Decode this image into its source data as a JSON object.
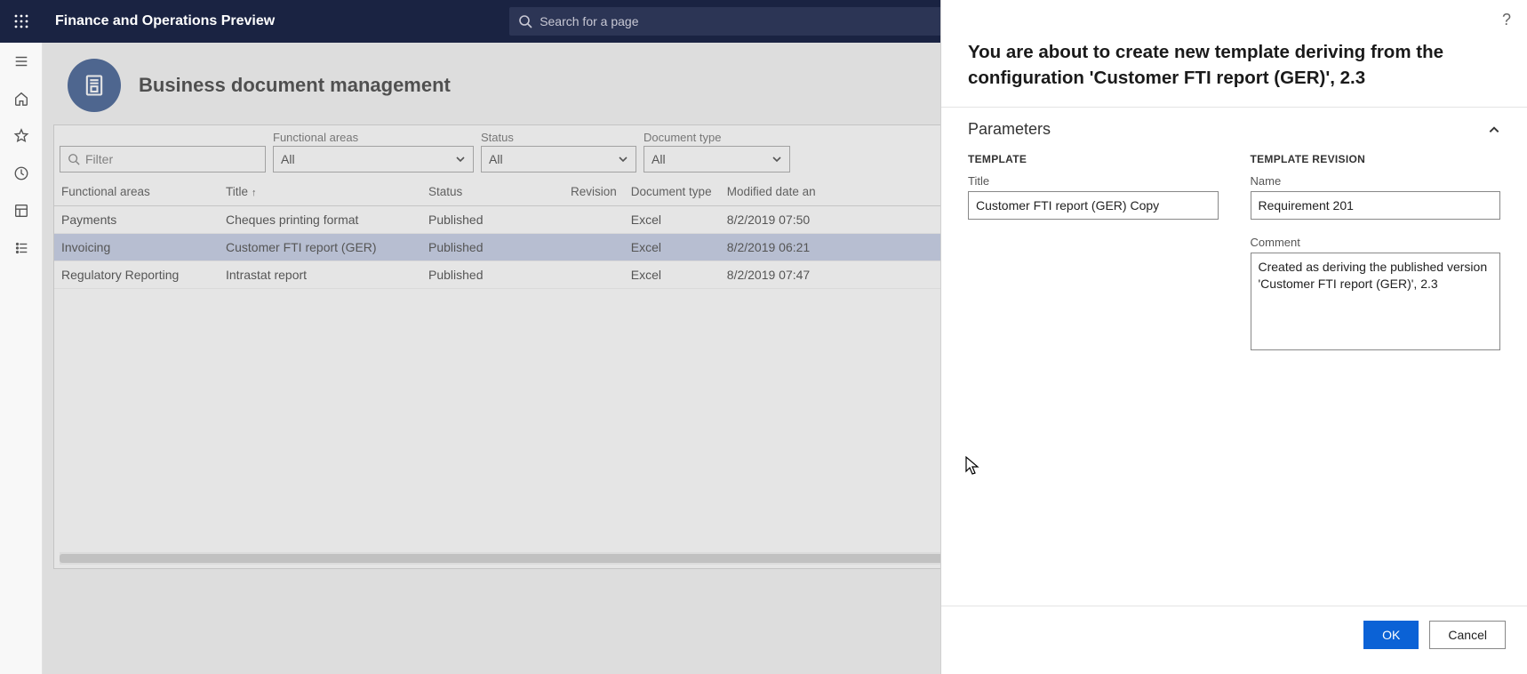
{
  "app_title": "Finance and Operations Preview",
  "search_placeholder": "Search for a page",
  "page_title": "Business document management",
  "filter_placeholder": "Filter",
  "filters": {
    "functional_areas": {
      "label": "Functional areas",
      "value": "All"
    },
    "status": {
      "label": "Status",
      "value": "All"
    },
    "document_type": {
      "label": "Document type",
      "value": "All"
    }
  },
  "columns": {
    "functional_areas": "Functional areas",
    "title": "Title",
    "status": "Status",
    "revision": "Revision",
    "document_type": "Document type",
    "modified": "Modified date an"
  },
  "rows": [
    {
      "fa": "Payments",
      "title": "Cheques printing format",
      "status": "Published",
      "revision": "",
      "doctype": "Excel",
      "modified": "8/2/2019 07:50"
    },
    {
      "fa": "Invoicing",
      "title": "Customer FTI report (GER)",
      "status": "Published",
      "revision": "",
      "doctype": "Excel",
      "modified": "8/2/2019 06:21"
    },
    {
      "fa": "Regulatory Reporting",
      "title": "Intrastat report",
      "status": "Published",
      "revision": "",
      "doctype": "Excel",
      "modified": "8/2/2019 07:47"
    }
  ],
  "panel": {
    "heading": "You are about to create new template deriving from the configuration 'Customer FTI report (GER)', 2.3",
    "parameters_label": "Parameters",
    "template_section": "TEMPLATE",
    "revision_section": "TEMPLATE REVISION",
    "title_label": "Title",
    "title_value": "Customer FTI report (GER) Copy",
    "name_label": "Name",
    "name_value": "Requirement 201",
    "comment_label": "Comment",
    "comment_value": "Created as deriving the published version 'Customer FTI report (GER)', 2.3",
    "ok": "OK",
    "cancel": "Cancel"
  }
}
